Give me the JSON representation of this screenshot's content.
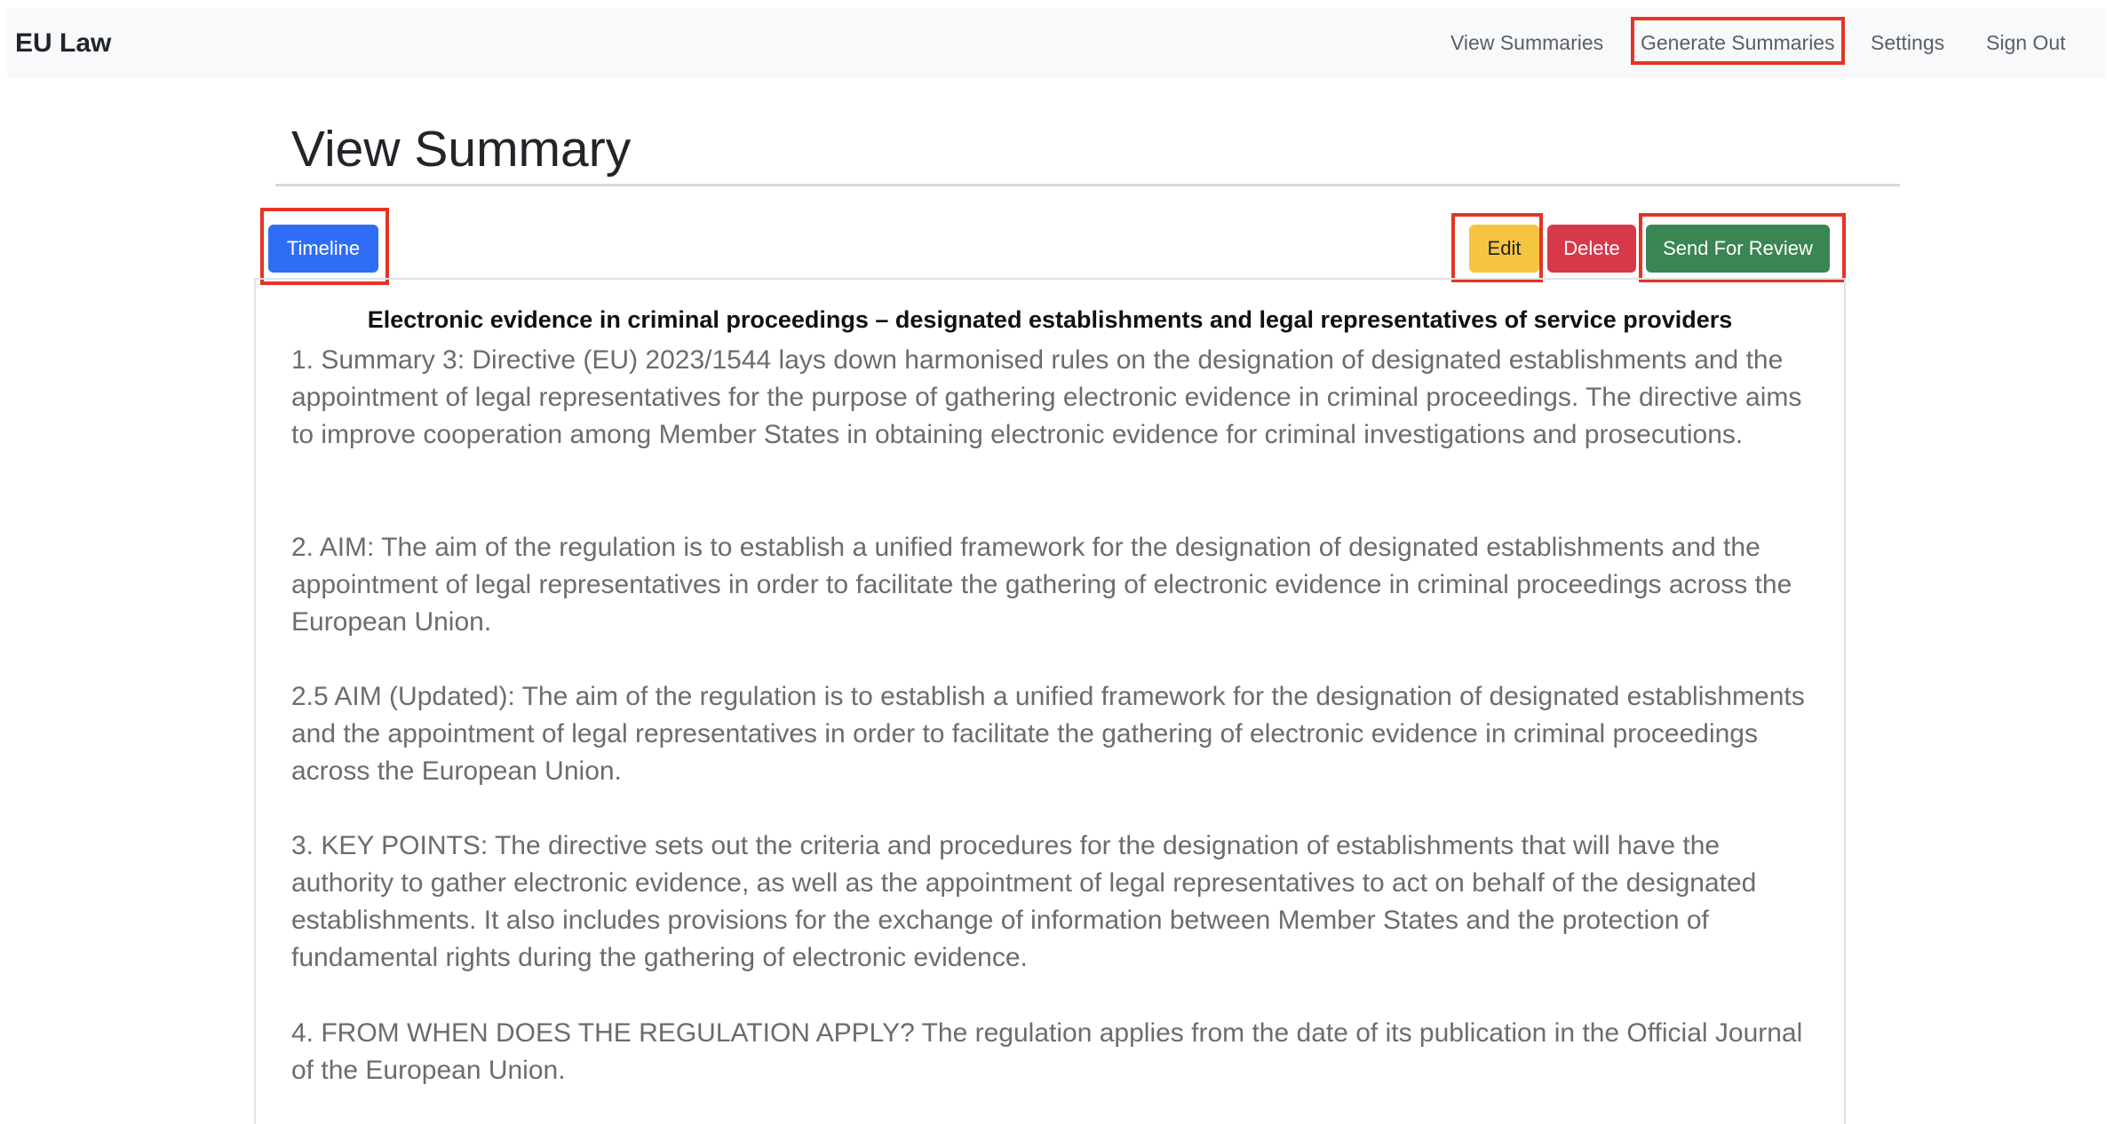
{
  "navbar": {
    "brand": "EU Law",
    "links": [
      {
        "label": "View Summaries"
      },
      {
        "label": "Generate Summaries"
      },
      {
        "label": "Settings"
      },
      {
        "label": "Sign Out"
      }
    ]
  },
  "page": {
    "title": "View Summary"
  },
  "toolbar": {
    "timeline_label": "Timeline",
    "edit_label": "Edit",
    "delete_label": "Delete",
    "review_label": "Send For Review"
  },
  "summary": {
    "title": "Electronic evidence in criminal proceedings – designated establishments and legal representatives of service providers",
    "paragraphs": [
      "1. Summary 3: Directive (EU) 2023/1544 lays down harmonised rules on the designation of designated establishments and the appointment of legal representatives for the purpose of gathering electronic evidence in criminal proceedings. The directive aims to improve cooperation among Member States in obtaining electronic evidence for criminal investigations and prosecutions.",
      "2. AIM: The aim of the regulation is to establish a unified framework for the designation of designated establishments and the appointment of legal representatives in order to facilitate the gathering of electronic evidence in criminal proceedings across the European Union.",
      "2.5 AIM (Updated): The aim of the regulation is to establish a unified framework for the designation of designated establishments and the appointment of legal representatives in order to facilitate the gathering of electronic evidence in criminal proceedings across the European Union.",
      "3. KEY POINTS: The directive sets out the criteria and procedures for the designation of establishments that will have the authority to gather electronic evidence, as well as the appointment of legal representatives to act on behalf of the designated establishments. It also includes provisions for the exchange of information between Member States and the protection of fundamental rights during the gathering of electronic evidence.",
      "4. FROM WHEN DOES THE REGULATION APPLY? The regulation applies from the date of its publication in the Official Journal of the European Union."
    ]
  },
  "colors": {
    "highlight": "#e63325",
    "primary": "#2f6df6",
    "warning": "#f5c542",
    "danger": "#d7384a",
    "success": "#3a8553"
  }
}
